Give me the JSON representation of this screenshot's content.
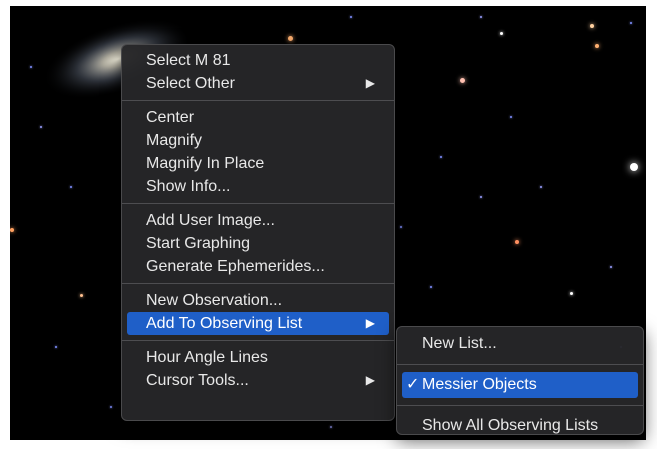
{
  "context_menu": {
    "groups": [
      [
        {
          "label": "Select M 81",
          "submenu": false
        },
        {
          "label": "Select Other",
          "submenu": true,
          "arrow": "▶"
        }
      ],
      [
        {
          "label": "Center",
          "submenu": false
        },
        {
          "label": "Magnify",
          "submenu": false
        },
        {
          "label": "Magnify In Place",
          "submenu": false
        },
        {
          "label": "Show Info...",
          "submenu": false
        }
      ],
      [
        {
          "label": "Add User Image...",
          "submenu": false
        },
        {
          "label": "Start Graphing",
          "submenu": false
        },
        {
          "label": "Generate Ephemerides...",
          "submenu": false
        }
      ],
      [
        {
          "label": "New Observation...",
          "submenu": false
        },
        {
          "label": "Add To Observing List",
          "submenu": true,
          "arrow": "▶",
          "highlighted": true
        }
      ],
      [
        {
          "label": "Hour Angle Lines",
          "submenu": false
        },
        {
          "label": "Cursor Tools...",
          "submenu": true,
          "arrow": "▶"
        }
      ]
    ]
  },
  "submenu": {
    "new_list": "New List...",
    "messier": {
      "check": "✓",
      "label": "Messier Objects",
      "highlighted": true
    },
    "show_all": "Show All Observing Lists"
  },
  "colors": {
    "highlight": "#1f5fc8",
    "menu_bg": "#262628",
    "sky": "#000000"
  }
}
